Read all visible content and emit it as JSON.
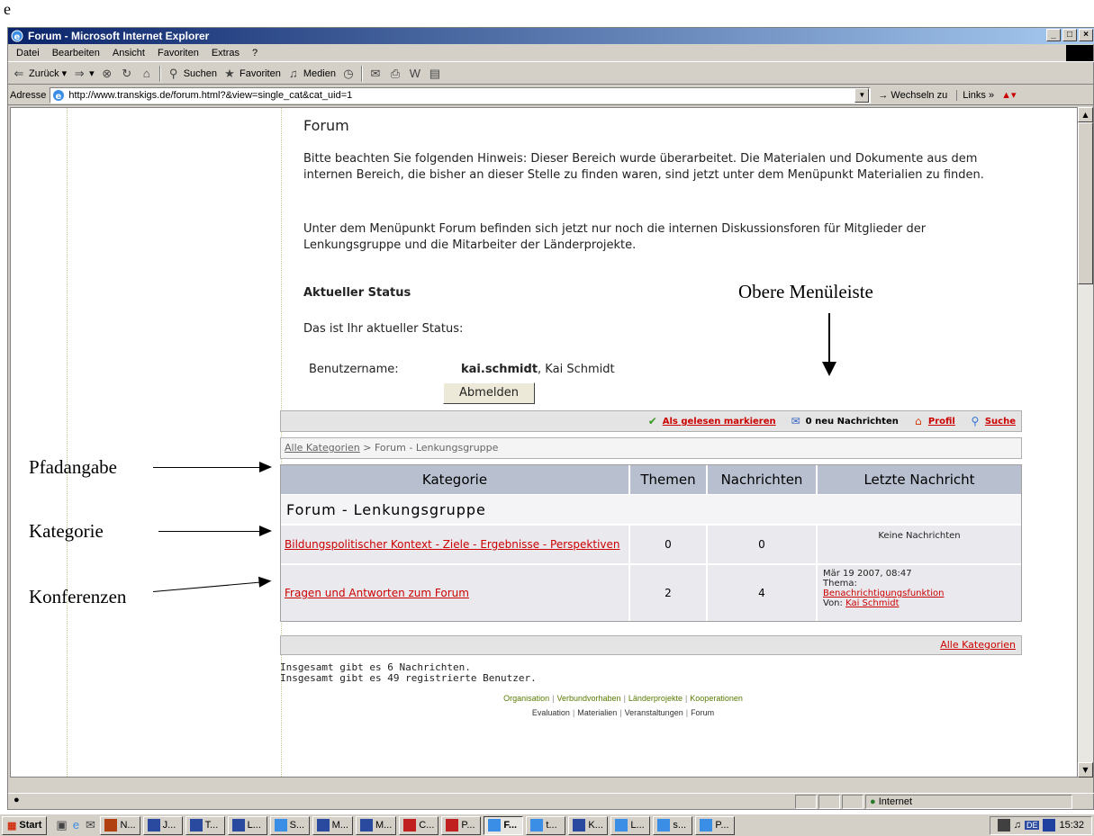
{
  "doc_letter": "e",
  "window": {
    "title": "Forum - Microsoft Internet Explorer",
    "buttons": [
      "_",
      "□",
      "×"
    ]
  },
  "menu": [
    "Datei",
    "Bearbeiten",
    "Ansicht",
    "Favoriten",
    "Extras",
    "?"
  ],
  "toolbar": {
    "back": "Zurück",
    "search": "Suchen",
    "favorites": "Favoriten",
    "media": "Medien"
  },
  "address": {
    "label": "Adresse",
    "url": "http://www.transkigs.de/forum.html?&view=single_cat&cat_uid=1",
    "go": "Wechseln zu",
    "links": "Links"
  },
  "page": {
    "title": "Forum",
    "notice": "Bitte beachten Sie folgenden Hinweis: Dieser Bereich wurde überarbeitet. Die Materialen und Dokumente aus dem internen Bereich, die bisher an dieser Stelle zu finden waren, sind jetzt unter dem Menüpunkt Materialien zu finden.",
    "info": "Unter dem Menüpunkt Forum befinden sich jetzt nur noch die internen Diskussionsforen für Mitglieder der Lenkungsgruppe und die Mitarbeiter der Länderprojekte.",
    "status_heading": "Aktueller Status",
    "status_line": "Das ist Ihr aktueller Status:",
    "user_label": "Benutzername:",
    "user_login": "kai.schmidt",
    "user_name": ", Kai Schmidt",
    "logout": "Abmelden"
  },
  "forum": {
    "toolbar": {
      "mark_read": "Als gelesen markieren",
      "new_messages": "0 neu Nachrichten",
      "profile": "Profil",
      "search": "Suche"
    },
    "breadcrumb": {
      "root": "Alle Kategorien",
      "rest": " > Forum - Lenkungsgruppe"
    },
    "headers": [
      "Kategorie",
      "Themen",
      "Nachrichten",
      "Letzte Nachricht"
    ],
    "category": "Forum - Lenkungsgruppe",
    "rows": [
      {
        "name": "Bildungspolitischer Kontext - Ziele - Ergebnisse - Perspektiven",
        "topics": "0",
        "messages": "0",
        "last": "Keine Nachrichten"
      },
      {
        "name": "Fragen und Antworten zum Forum",
        "topics": "2",
        "messages": "4",
        "last_date": "Mär 19 2007, 08:47",
        "last_topic_label": "Thema:",
        "last_topic": "Benachrichtigungsfunktion",
        "last_by_label": "Von: ",
        "last_by": "Kai Schmidt"
      }
    ],
    "footer_link": "Alle Kategorien"
  },
  "totals": {
    "messages": "Insgesamt gibt es 6 Nachrichten.",
    "users": "Insgesamt gibt es 49 registrierte Benutzer."
  },
  "sitenav": {
    "row1": [
      "Organisation",
      "Verbundvorhaben",
      "Länderprojekte",
      "Kooperationen"
    ],
    "row2": [
      "Evaluation",
      "Materialien",
      "Veranstaltungen",
      "Forum"
    ]
  },
  "annotations": {
    "top_menu": "Obere Menüleiste",
    "path": "Pfadangabe",
    "category": "Kategorie",
    "conferences": "Konferenzen"
  },
  "statusbar": {
    "zone": "Internet"
  },
  "taskbar": {
    "start": "Start",
    "tasks": [
      "N...",
      "J...",
      "T...",
      "L...",
      "S...",
      "M...",
      "M...",
      "C...",
      "P...",
      "F...",
      "t...",
      "K...",
      "L...",
      "s...",
      "P..."
    ],
    "active_index": 9,
    "clock": "15:32",
    "lang": "DE"
  },
  "colors": {
    "title_bar": "#0a246a",
    "link_red": "#cc0000",
    "table_header": "#b8c0d0",
    "chrome": "#d4d0c8"
  }
}
